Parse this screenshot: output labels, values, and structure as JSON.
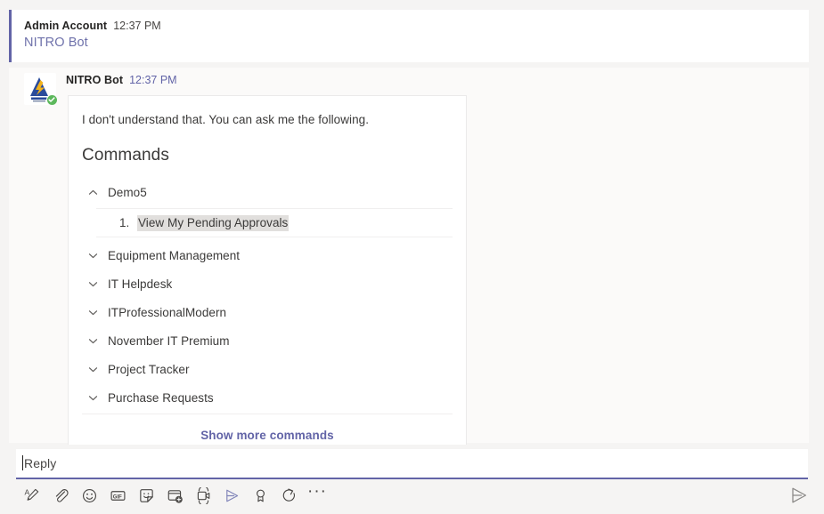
{
  "thread": {
    "parent": {
      "author": "Admin Account",
      "time": "12:37 PM",
      "bot_mention": "NITRO Bot"
    },
    "reply": {
      "bot_name": "NITRO Bot",
      "time": "12:37 PM",
      "avatar_alt": "nitro-bot-logo",
      "verified_badge": "verified-check-icon"
    }
  },
  "card": {
    "intro": "I don't understand that. You can ask me the following.",
    "title": "Commands",
    "groups": [
      {
        "label": "Demo5",
        "expanded": true,
        "chevron": "chevron-up-icon"
      },
      {
        "label": "Equipment Management",
        "expanded": false,
        "chevron": "chevron-down-icon"
      },
      {
        "label": "IT Helpdesk",
        "expanded": false,
        "chevron": "chevron-down-icon"
      },
      {
        "label": "ITProfessionalModern",
        "expanded": false,
        "chevron": "chevron-down-icon"
      },
      {
        "label": "November IT Premium",
        "expanded": false,
        "chevron": "chevron-down-icon"
      },
      {
        "label": "Project Tracker",
        "expanded": false,
        "chevron": "chevron-down-icon"
      },
      {
        "label": "Purchase Requests",
        "expanded": false,
        "chevron": "chevron-down-icon"
      }
    ],
    "expanded_commands": [
      {
        "number": "1.",
        "label": "View My Pending Approvals",
        "highlighted": true
      }
    ],
    "show_more": "Show more commands"
  },
  "compose": {
    "placeholder": "Reply",
    "value": "",
    "toolbar": [
      {
        "name": "format-text-icon",
        "title": "Format"
      },
      {
        "name": "attach-file-icon",
        "title": "Attach"
      },
      {
        "name": "emoji-icon",
        "title": "Emoji"
      },
      {
        "name": "gif-icon",
        "title": "Giphy",
        "text": "GIF"
      },
      {
        "name": "sticker-icon",
        "title": "Sticker"
      },
      {
        "name": "schedule-meeting-icon",
        "title": "Schedule a meeting"
      },
      {
        "name": "video-clip-icon",
        "title": "Record a video clip"
      },
      {
        "name": "stream-icon",
        "title": "Stream"
      },
      {
        "name": "praise-icon",
        "title": "Praise"
      },
      {
        "name": "loop-components-icon",
        "title": "Loop components"
      },
      {
        "name": "more-options-icon",
        "title": "More options",
        "text": "···"
      }
    ],
    "send": {
      "name": "send-icon",
      "title": "Send"
    }
  },
  "colors": {
    "accent_purple": "#6264a7",
    "mention_purple": "#6f72ab",
    "highlight_gray": "#e1dfdd",
    "page_bg": "#f5f4f3",
    "card_bg": "#ffffff",
    "badge_green": "#5cb85c"
  }
}
